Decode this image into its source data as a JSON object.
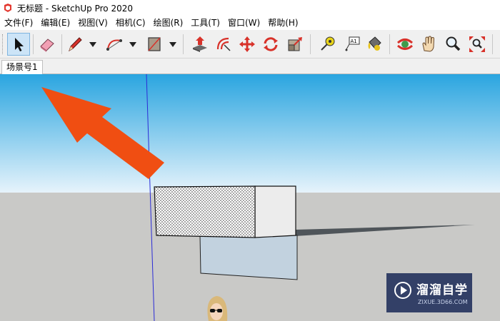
{
  "window": {
    "title": "无标题 - SketchUp Pro 2020",
    "app_icon": "sketchup-logo-icon"
  },
  "menubar": {
    "items": [
      {
        "label": "文件(F)"
      },
      {
        "label": "编辑(E)"
      },
      {
        "label": "视图(V)"
      },
      {
        "label": "相机(C)"
      },
      {
        "label": "绘图(R)"
      },
      {
        "label": "工具(T)"
      },
      {
        "label": "窗口(W)"
      },
      {
        "label": "帮助(H)"
      }
    ]
  },
  "toolbar": {
    "tools": [
      {
        "name": "select",
        "icon": "select-arrow-icon",
        "active": true
      },
      {
        "name": "eraser",
        "icon": "eraser-icon"
      },
      {
        "name": "line",
        "icon": "pencil-icon"
      },
      {
        "name": "arc",
        "icon": "arc-icon"
      },
      {
        "name": "rectangle",
        "icon": "rectangle-icon"
      },
      {
        "name": "push-pull",
        "icon": "push-pull-icon"
      },
      {
        "name": "offset",
        "icon": "offset-icon"
      },
      {
        "name": "move",
        "icon": "move-icon"
      },
      {
        "name": "rotate",
        "icon": "rotate-icon"
      },
      {
        "name": "scale",
        "icon": "scale-icon"
      },
      {
        "name": "tape-measure",
        "icon": "tape-measure-icon"
      },
      {
        "name": "text",
        "icon": "text-label-icon",
        "label": "A1"
      },
      {
        "name": "paint-bucket",
        "icon": "paint-bucket-icon"
      },
      {
        "name": "orbit",
        "icon": "orbit-icon"
      },
      {
        "name": "pan",
        "icon": "pan-hand-icon"
      },
      {
        "name": "zoom",
        "icon": "zoom-icon"
      },
      {
        "name": "zoom-extents",
        "icon": "zoom-extents-icon"
      }
    ]
  },
  "scene_tabs": {
    "tabs": [
      {
        "label": "场景号1"
      }
    ]
  },
  "viewport": {
    "sky_top": "#2aa5e0",
    "sky_bottom": "#e6f3fb",
    "ground": "#c9c9c7",
    "annotation_arrow_color": "#f04e12"
  },
  "watermark": {
    "title": "溜溜自学",
    "url": "ZIXUE.3D66.COM",
    "logo": "play-logo-icon"
  }
}
